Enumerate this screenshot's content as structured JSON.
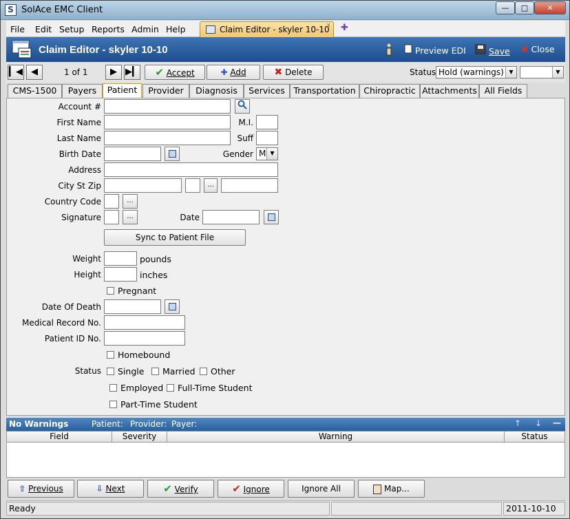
{
  "window": {
    "title": "SolAce EMC Client",
    "app_icon": "S"
  },
  "menu": [
    "File",
    "Edit",
    "Setup",
    "Reports",
    "Admin",
    "Help"
  ],
  "doc_tab": {
    "label": "Claim Editor - skyler 10-10",
    "close": "x"
  },
  "header": {
    "title": "Claim Editor - skyler 10-10",
    "preview_edi": "Preview EDI",
    "save": "Save",
    "close": "Close"
  },
  "toolbar": {
    "record_count": "1 of 1",
    "accept": "Accept",
    "add": "Add",
    "delete": "Delete",
    "status_label": "Status",
    "status_value": "Hold (warnings)",
    "status2_value": ""
  },
  "tabs": [
    "CMS-1500",
    "Payers",
    "Patient",
    "Provider",
    "Diagnosis",
    "Services",
    "Transportation",
    "Chiropractic",
    "Attachments",
    "All Fields"
  ],
  "active_tab": "Patient",
  "form": {
    "account": "Account #",
    "first_name": "First Name",
    "mi": "M.I.",
    "last_name": "Last Name",
    "suff": "Suff",
    "birth_date": "Birth Date",
    "gender": "Gender",
    "gender_value": "M",
    "address": "Address",
    "city_st_zip": "City St Zip",
    "country_code": "Country Code",
    "signature": "Signature",
    "date": "Date",
    "sync": "Sync to Patient File",
    "weight": "Weight",
    "pounds": "pounds",
    "height": "Height",
    "inches": "inches",
    "pregnant": "Pregnant",
    "date_of_death": "Date Of Death",
    "medical_record": "Medical Record No.",
    "patient_id": "Patient ID No.",
    "homebound": "Homebound",
    "status": "Status",
    "single": "Single",
    "married": "Married",
    "other": "Other",
    "employed": "Employed",
    "full_time_student": "Full-Time Student",
    "part_time_student": "Part-Time Student",
    "ellipsis": "..."
  },
  "warnings": {
    "title": "No Warnings",
    "patient": "Patient:",
    "provider": "Provider:",
    "payer": "Payer:",
    "columns": [
      "Field",
      "Severity",
      "Warning",
      "Status"
    ]
  },
  "bottom": {
    "previous": "Previous",
    "next": "Next",
    "verify": "Verify",
    "ignore": "Ignore",
    "ignore_all": "Ignore All",
    "map": "Map..."
  },
  "statusbar": {
    "state": "Ready",
    "date": "2011-10-10"
  },
  "colors": {
    "header": "#2b5f9e",
    "active_tab": "#e0a000",
    "doc_tab": "#f2c86a"
  }
}
